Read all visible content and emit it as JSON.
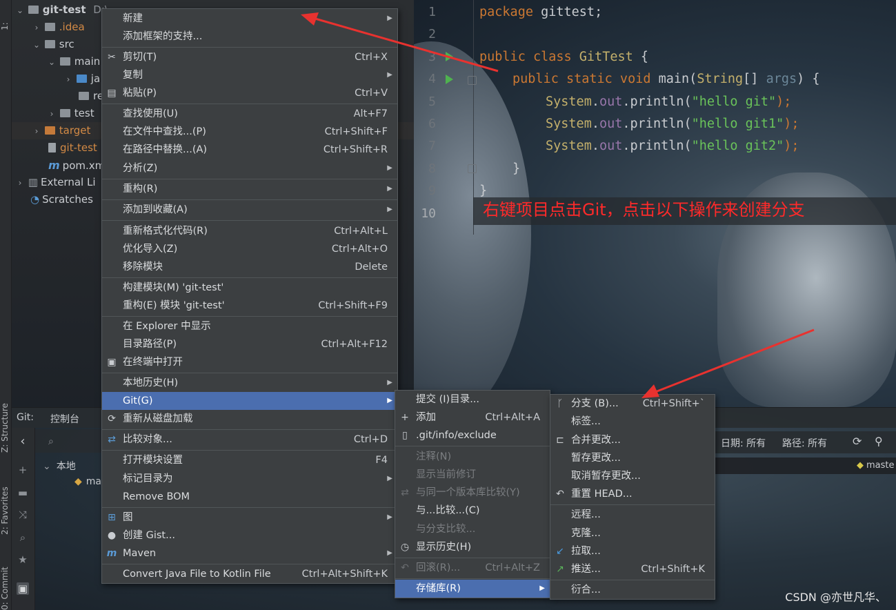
{
  "project_tree": {
    "root": {
      "name": "git-test",
      "path_hint": "D:\\..."
    },
    "items": [
      {
        "label": ".idea"
      },
      {
        "label": "src"
      },
      {
        "label": "main"
      },
      {
        "label": "ja"
      },
      {
        "label": "re"
      },
      {
        "label": "test"
      },
      {
        "label": "target"
      },
      {
        "label": "git-test"
      },
      {
        "label": "pom.xml"
      },
      {
        "label": "External Li"
      },
      {
        "label": "Scratches"
      }
    ]
  },
  "editor": {
    "line_numbers": [
      "1",
      "2",
      "3",
      "4",
      "5",
      "6",
      "7",
      "8",
      "9",
      "10"
    ],
    "lines": {
      "l1": {
        "kw": "package",
        "rest": " gittest;"
      },
      "l3": {
        "kw": "public class",
        "cls": " GitTest",
        "rest": " {"
      },
      "l4": {
        "kw": "public static void",
        "rest1": " main(",
        "cls": "String",
        "rest2": "[] ",
        "param": "args",
        "rest3": ") {"
      },
      "l5": {
        "cls": "System",
        "dot": ".",
        "fld": "out",
        "call": ".println(",
        "str": "\"hello git\"",
        "end": ");"
      },
      "l6": {
        "cls": "System",
        "dot": ".",
        "fld": "out",
        "call": ".println(",
        "str": "\"hello git1\"",
        "end": ");"
      },
      "l7": {
        "cls": "System",
        "dot": ".",
        "fld": "out",
        "call": ".println(",
        "str": "\"hello git2\"",
        "end": ");"
      },
      "l8": {
        "rest": "}"
      },
      "l9": {
        "rest": "}"
      }
    },
    "annotation": "右键项目点击Git，点击以下操作来创建分支"
  },
  "context_menu": {
    "items": [
      {
        "label": "新建",
        "submenu": true
      },
      {
        "label": "添加框架的支持..."
      },
      {
        "label": "剪切(T)",
        "shortcut": "Ctrl+X",
        "icon": "scissors-icon"
      },
      {
        "label": "复制",
        "submenu": true
      },
      {
        "label": "粘贴(P)",
        "shortcut": "Ctrl+V",
        "icon": "paste-icon"
      },
      {
        "label": "查找使用(U)",
        "shortcut": "Alt+F7"
      },
      {
        "label": "在文件中查找...(P)",
        "shortcut": "Ctrl+Shift+F"
      },
      {
        "label": "在路径中替换...(A)",
        "shortcut": "Ctrl+Shift+R"
      },
      {
        "label": "分析(Z)",
        "submenu": true
      },
      {
        "label": "重构(R)",
        "submenu": true
      },
      {
        "label": "添加到收藏(A)",
        "submenu": true
      },
      {
        "label": "重新格式化代码(R)",
        "shortcut": "Ctrl+Alt+L"
      },
      {
        "label": "优化导入(Z)",
        "shortcut": "Ctrl+Alt+O"
      },
      {
        "label": "移除模块",
        "shortcut": "Delete"
      },
      {
        "label": "构建模块(M) 'git-test'"
      },
      {
        "label": "重构(E) 模块 'git-test'",
        "shortcut": "Ctrl+Shift+F9"
      },
      {
        "label": "在 Explorer 中显示"
      },
      {
        "label": "目录路径(P)",
        "shortcut": "Ctrl+Alt+F12"
      },
      {
        "label": "在终端中打开",
        "icon": "terminal-icon"
      },
      {
        "label": "本地历史(H)",
        "submenu": true
      },
      {
        "label": "Git(G)",
        "submenu": true,
        "selected": true
      },
      {
        "label": "重新从磁盘加载",
        "icon": "reload-icon"
      },
      {
        "label": "比较对象...",
        "shortcut": "Ctrl+D",
        "icon": "compare-icon"
      },
      {
        "label": "打开模块设置",
        "shortcut": "F4"
      },
      {
        "label": "标记目录为",
        "submenu": true
      },
      {
        "label": "Remove BOM"
      },
      {
        "label": "图",
        "submenu": true,
        "icon": "diagram-icon"
      },
      {
        "label": "创建 Gist...",
        "icon": "github-icon"
      },
      {
        "label": "Maven",
        "submenu": true,
        "icon": "maven-icon"
      },
      {
        "label": "Convert Java File to Kotlin File",
        "shortcut": "Ctrl+Alt+Shift+K"
      }
    ]
  },
  "git_submenu": {
    "items": [
      {
        "label": "提交 (I)目录..."
      },
      {
        "label": "添加",
        "shortcut": "Ctrl+Alt+A",
        "icon": "plus-icon"
      },
      {
        "label": ".git/info/exclude",
        "icon": "file-icon"
      },
      {
        "label": "注释(N)",
        "disabled": true
      },
      {
        "label": "显示当前修订",
        "disabled": true
      },
      {
        "label": "与同一个版本库比较(Y)",
        "disabled": true,
        "icon": "compare-icon"
      },
      {
        "label": "与...比较...(C)"
      },
      {
        "label": "与分支比较...",
        "disabled": true
      },
      {
        "label": "显示历史(H)",
        "icon": "clock-icon"
      },
      {
        "label": "回滚(R)...",
        "shortcut": "Ctrl+Alt+Z",
        "disabled": true,
        "icon": "rollback-icon"
      },
      {
        "label": "存储库(R)",
        "submenu": true,
        "selected": true
      }
    ]
  },
  "repo_submenu": {
    "items": [
      {
        "label": "分支 (B)...",
        "shortcut": "Ctrl+Shift+`",
        "icon": "branch-icon"
      },
      {
        "label": "标签..."
      },
      {
        "label": "合并更改...",
        "icon": "merge-icon"
      },
      {
        "label": "暂存更改..."
      },
      {
        "label": "取消暂存更改..."
      },
      {
        "label": "重置 HEAD...",
        "icon": "reset-icon"
      },
      {
        "label": "远程..."
      },
      {
        "label": "克隆..."
      },
      {
        "label": "拉取...",
        "icon": "pull-icon"
      },
      {
        "label": "推送...",
        "shortcut": "Ctrl+Shift+K",
        "icon": "push-icon"
      },
      {
        "label": "衍合..."
      }
    ]
  },
  "bottom_panel": {
    "git_label": "Git:",
    "console_tab": "控制台",
    "local_label": "本地",
    "branch_stub": "ma",
    "date_filter": "日期: 所有",
    "path_filter": "路径: 所有",
    "branch_badge": "maste"
  },
  "left_strip": {
    "project_tab": "1:",
    "structure_tab": "Z: Structure",
    "favorites_tab": "2: Favorites",
    "commit_tab": "0: Commit"
  },
  "watermark": "CSDN @亦世凡华、",
  "colors": {
    "selection": "#4b6eaf",
    "menu_bg": "#3c3f41",
    "annotation": "#ff2a2a",
    "arrow": "#e8322f"
  }
}
